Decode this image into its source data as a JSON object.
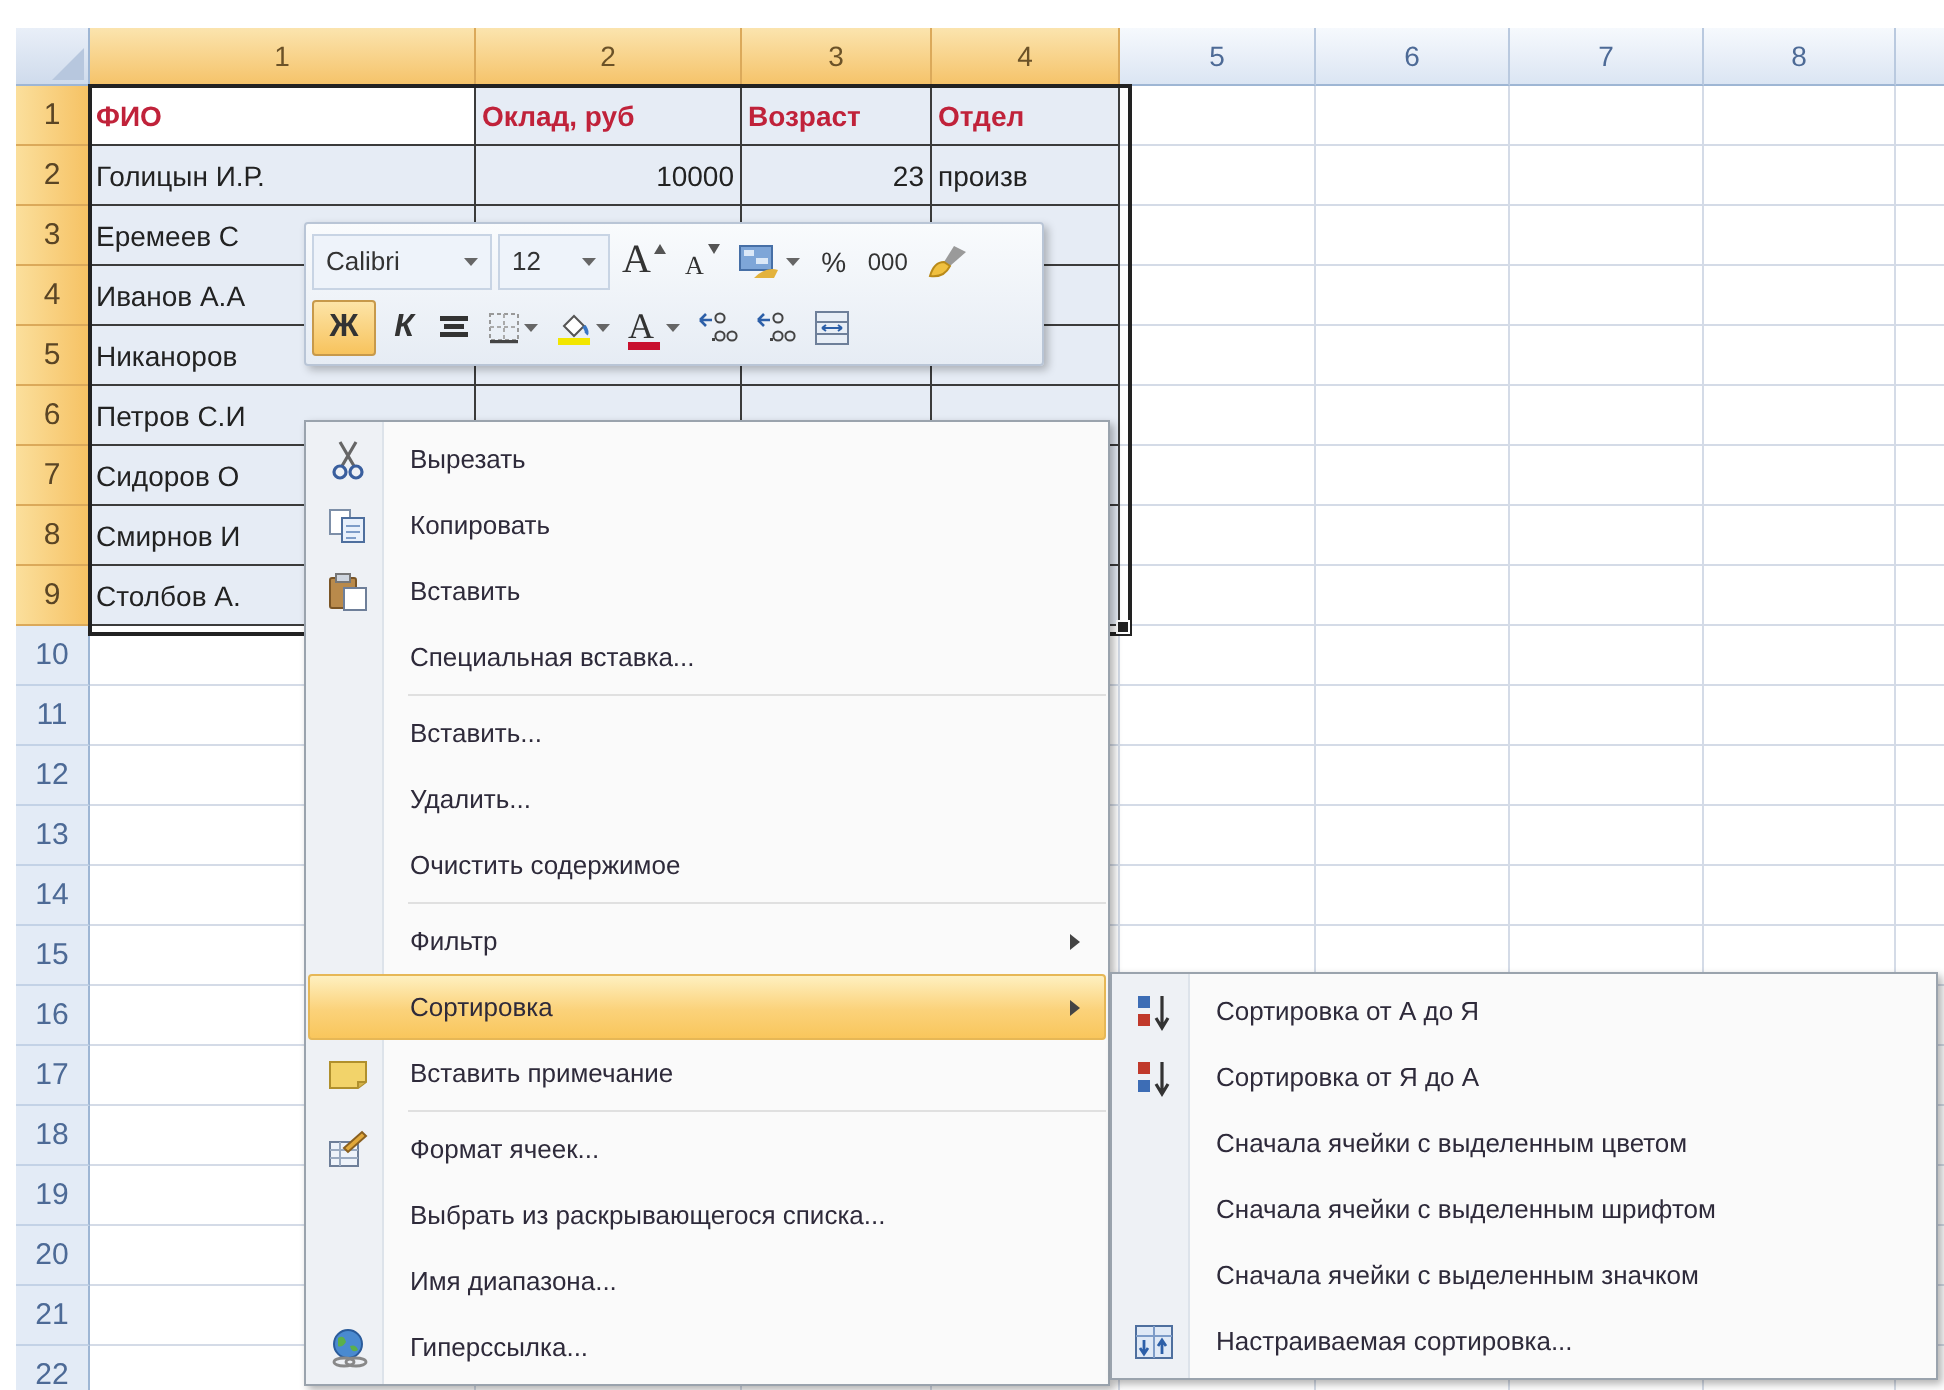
{
  "spreadsheet": {
    "columns": [
      {
        "label": "1",
        "selected": true
      },
      {
        "label": "2",
        "selected": true
      },
      {
        "label": "3",
        "selected": true
      },
      {
        "label": "4",
        "selected": true
      },
      {
        "label": "5",
        "selected": false
      },
      {
        "label": "6",
        "selected": false
      },
      {
        "label": "7",
        "selected": false
      },
      {
        "label": "8",
        "selected": false
      }
    ],
    "rows": [
      {
        "number": "1",
        "selected": true,
        "cells": [
          {
            "text": "ФИО",
            "kind": "heading",
            "active": true
          },
          {
            "text": "Оклад, руб",
            "kind": "heading",
            "active": false
          },
          {
            "text": "Возраст",
            "kind": "heading",
            "active": false
          },
          {
            "text": "Отдел",
            "kind": "heading",
            "active": false
          }
        ]
      },
      {
        "number": "2",
        "selected": true,
        "cells": [
          {
            "text": "Голицын И.Р.",
            "kind": "text",
            "active": false
          },
          {
            "text": "10000",
            "kind": "number",
            "active": false
          },
          {
            "text": "23",
            "kind": "number",
            "active": false
          },
          {
            "text": "произв",
            "kind": "text",
            "active": false
          }
        ]
      },
      {
        "number": "3",
        "selected": true,
        "cells": [
          {
            "text": "Еремеев С",
            "kind": "text",
            "active": false
          }
        ]
      },
      {
        "number": "4",
        "selected": true,
        "cells": [
          {
            "text": "Иванов А.А",
            "kind": "text",
            "active": false
          }
        ]
      },
      {
        "number": "5",
        "selected": true,
        "cells": [
          {
            "text": "Никаноров",
            "kind": "text",
            "active": false
          }
        ]
      },
      {
        "number": "6",
        "selected": true,
        "cells": [
          {
            "text": "Петров С.И",
            "kind": "text",
            "active": false
          }
        ]
      },
      {
        "number": "7",
        "selected": true,
        "cells": [
          {
            "text": "Сидоров О",
            "kind": "text",
            "active": false
          }
        ]
      },
      {
        "number": "8",
        "selected": true,
        "cells": [
          {
            "text": "Смирнов И",
            "kind": "text",
            "active": false
          }
        ]
      },
      {
        "number": "9",
        "selected": true,
        "cells": [
          {
            "text": "Столбов А.",
            "kind": "text",
            "active": false
          }
        ]
      },
      {
        "number": "10",
        "selected": false
      },
      {
        "number": "11",
        "selected": false
      },
      {
        "number": "12",
        "selected": false
      },
      {
        "number": "13",
        "selected": false
      },
      {
        "number": "14",
        "selected": false
      },
      {
        "number": "15",
        "selected": false
      },
      {
        "number": "16",
        "selected": false
      },
      {
        "number": "17",
        "selected": false
      },
      {
        "number": "18",
        "selected": false
      },
      {
        "number": "19",
        "selected": false
      },
      {
        "number": "20",
        "selected": false
      },
      {
        "number": "21",
        "selected": false
      },
      {
        "number": "22",
        "selected": false
      }
    ]
  },
  "mini_toolbar": {
    "font": "Calibri",
    "size": "12",
    "top_buttons": [
      {
        "kind": "grow",
        "label": "A"
      },
      {
        "kind": "shrink",
        "label": "A"
      },
      {
        "kind": "styles",
        "dropdown": true
      },
      {
        "kind": "percent",
        "label": "%"
      },
      {
        "kind": "thousands",
        "label": "000"
      },
      {
        "kind": "painter"
      }
    ],
    "bottom_buttons": [
      {
        "kind": "bold",
        "label": "Ж",
        "selected": true
      },
      {
        "kind": "italic",
        "label": "К",
        "selected": false
      },
      {
        "kind": "align",
        "selected": false
      },
      {
        "kind": "borders",
        "dropdown": true,
        "selected": false
      },
      {
        "kind": "fill",
        "dropdown": true,
        "selected": false
      },
      {
        "kind": "fontcolor",
        "label": "A",
        "dropdown": true,
        "selected": false
      },
      {
        "kind": "incdec",
        "selected": false
      },
      {
        "kind": "decdec",
        "selected": false
      },
      {
        "kind": "merge",
        "selected": false
      }
    ]
  },
  "context_menu": {
    "items": [
      {
        "kind": "cut",
        "label": "Вырезать",
        "has_submenu": false,
        "selected": false
      },
      {
        "kind": "copy",
        "label": "Копировать",
        "has_submenu": false,
        "selected": false
      },
      {
        "kind": "paste",
        "label": "Вставить",
        "has_submenu": false,
        "selected": false
      },
      {
        "kind": "plain",
        "label": "Специальная вставка...",
        "has_submenu": false,
        "selected": false
      },
      {
        "kind": "separator"
      },
      {
        "kind": "plain",
        "label": "Вставить...",
        "has_submenu": false,
        "selected": false
      },
      {
        "kind": "plain",
        "label": "Удалить...",
        "has_submenu": false,
        "selected": false
      },
      {
        "kind": "plain",
        "label": "Очистить содержимое",
        "has_submenu": false,
        "selected": false
      },
      {
        "kind": "separator"
      },
      {
        "kind": "plain",
        "label": "Фильтр",
        "has_submenu": true,
        "selected": false
      },
      {
        "kind": "plain",
        "label": "Сортировка",
        "has_submenu": true,
        "selected": true
      },
      {
        "kind": "note",
        "label": "Вставить примечание",
        "has_submenu": false,
        "selected": false
      },
      {
        "kind": "separator"
      },
      {
        "kind": "format",
        "label": "Формат ячеек...",
        "has_submenu": false,
        "selected": false
      },
      {
        "kind": "plain",
        "label": "Выбрать из раскрывающегося списка...",
        "has_submenu": false,
        "selected": false
      },
      {
        "kind": "plain",
        "label": "Имя диапазона...",
        "has_submenu": false,
        "selected": false
      },
      {
        "kind": "globe",
        "label": "Гиперссылка...",
        "has_submenu": false,
        "selected": false
      }
    ]
  },
  "submenu": {
    "items": [
      {
        "kind": "sort-up",
        "label": "Сортировка от А до Я"
      },
      {
        "kind": "sort-down",
        "label": "Сортировка от Я до А"
      },
      {
        "kind": "plain",
        "label": "Сначала ячейки с выделенным цветом"
      },
      {
        "kind": "plain",
        "label": "Сначала ячейки с выделенным шрифтом"
      },
      {
        "kind": "plain",
        "label": "Сначала ячейки с выделенным значком"
      },
      {
        "kind": "custom",
        "label": "Настраиваемая сортировка..."
      }
    ]
  }
}
